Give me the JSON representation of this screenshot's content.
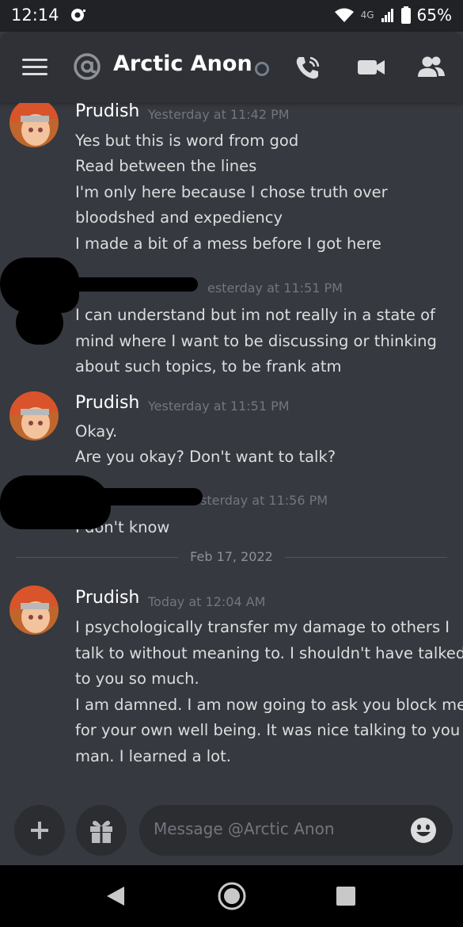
{
  "status_bar": {
    "time": "12:14",
    "network": "4G",
    "battery": "65%"
  },
  "header": {
    "title": "Arctic Anon",
    "icons": [
      "menu-icon",
      "at-icon",
      "status-idle-icon",
      "voice-call-icon",
      "video-call-icon",
      "members-icon"
    ]
  },
  "messages": [
    {
      "author": "Prudish",
      "timestamp": "Yesterday at 11:42 PM",
      "lines": [
        "Yes but this is word from god",
        "Read between the lines",
        "I'm only here because I chose truth over",
        "bloodshed and expediency",
        "I made a bit of a mess before I got here"
      ]
    },
    {
      "author": "",
      "timestamp": "esterday at 11:51 PM",
      "lines": [
        "I can understand but im not really in a state of",
        "mind where I want to be discussing or thinking",
        "about such topics, to be frank atm"
      ]
    },
    {
      "author": "Prudish",
      "timestamp": "Yesterday at 11:51 PM",
      "lines": [
        "Okay.",
        "Are you okay? Don't want to talk?"
      ]
    },
    {
      "author": "",
      "timestamp": "sterday at 11:56 PM",
      "lines": [
        "I don't know"
      ]
    },
    {
      "author": "Prudish",
      "timestamp": "Today at 12:04 AM",
      "lines": [
        "I psychologically transfer my damage to others I",
        "talk to without meaning to. I shouldn't have talked",
        "to you so much.",
        "I am damned. I am now going to ask you block me",
        "for your own well being. It was nice talking to you",
        "man. I learned a lot."
      ]
    }
  ],
  "date_divider": "Feb 17, 2022",
  "composer": {
    "placeholder": "Message @Arctic Anon"
  },
  "colors": {
    "background": "#36393f",
    "header": "#2f3136",
    "text": "#dcddde",
    "muted": "#72767d"
  }
}
